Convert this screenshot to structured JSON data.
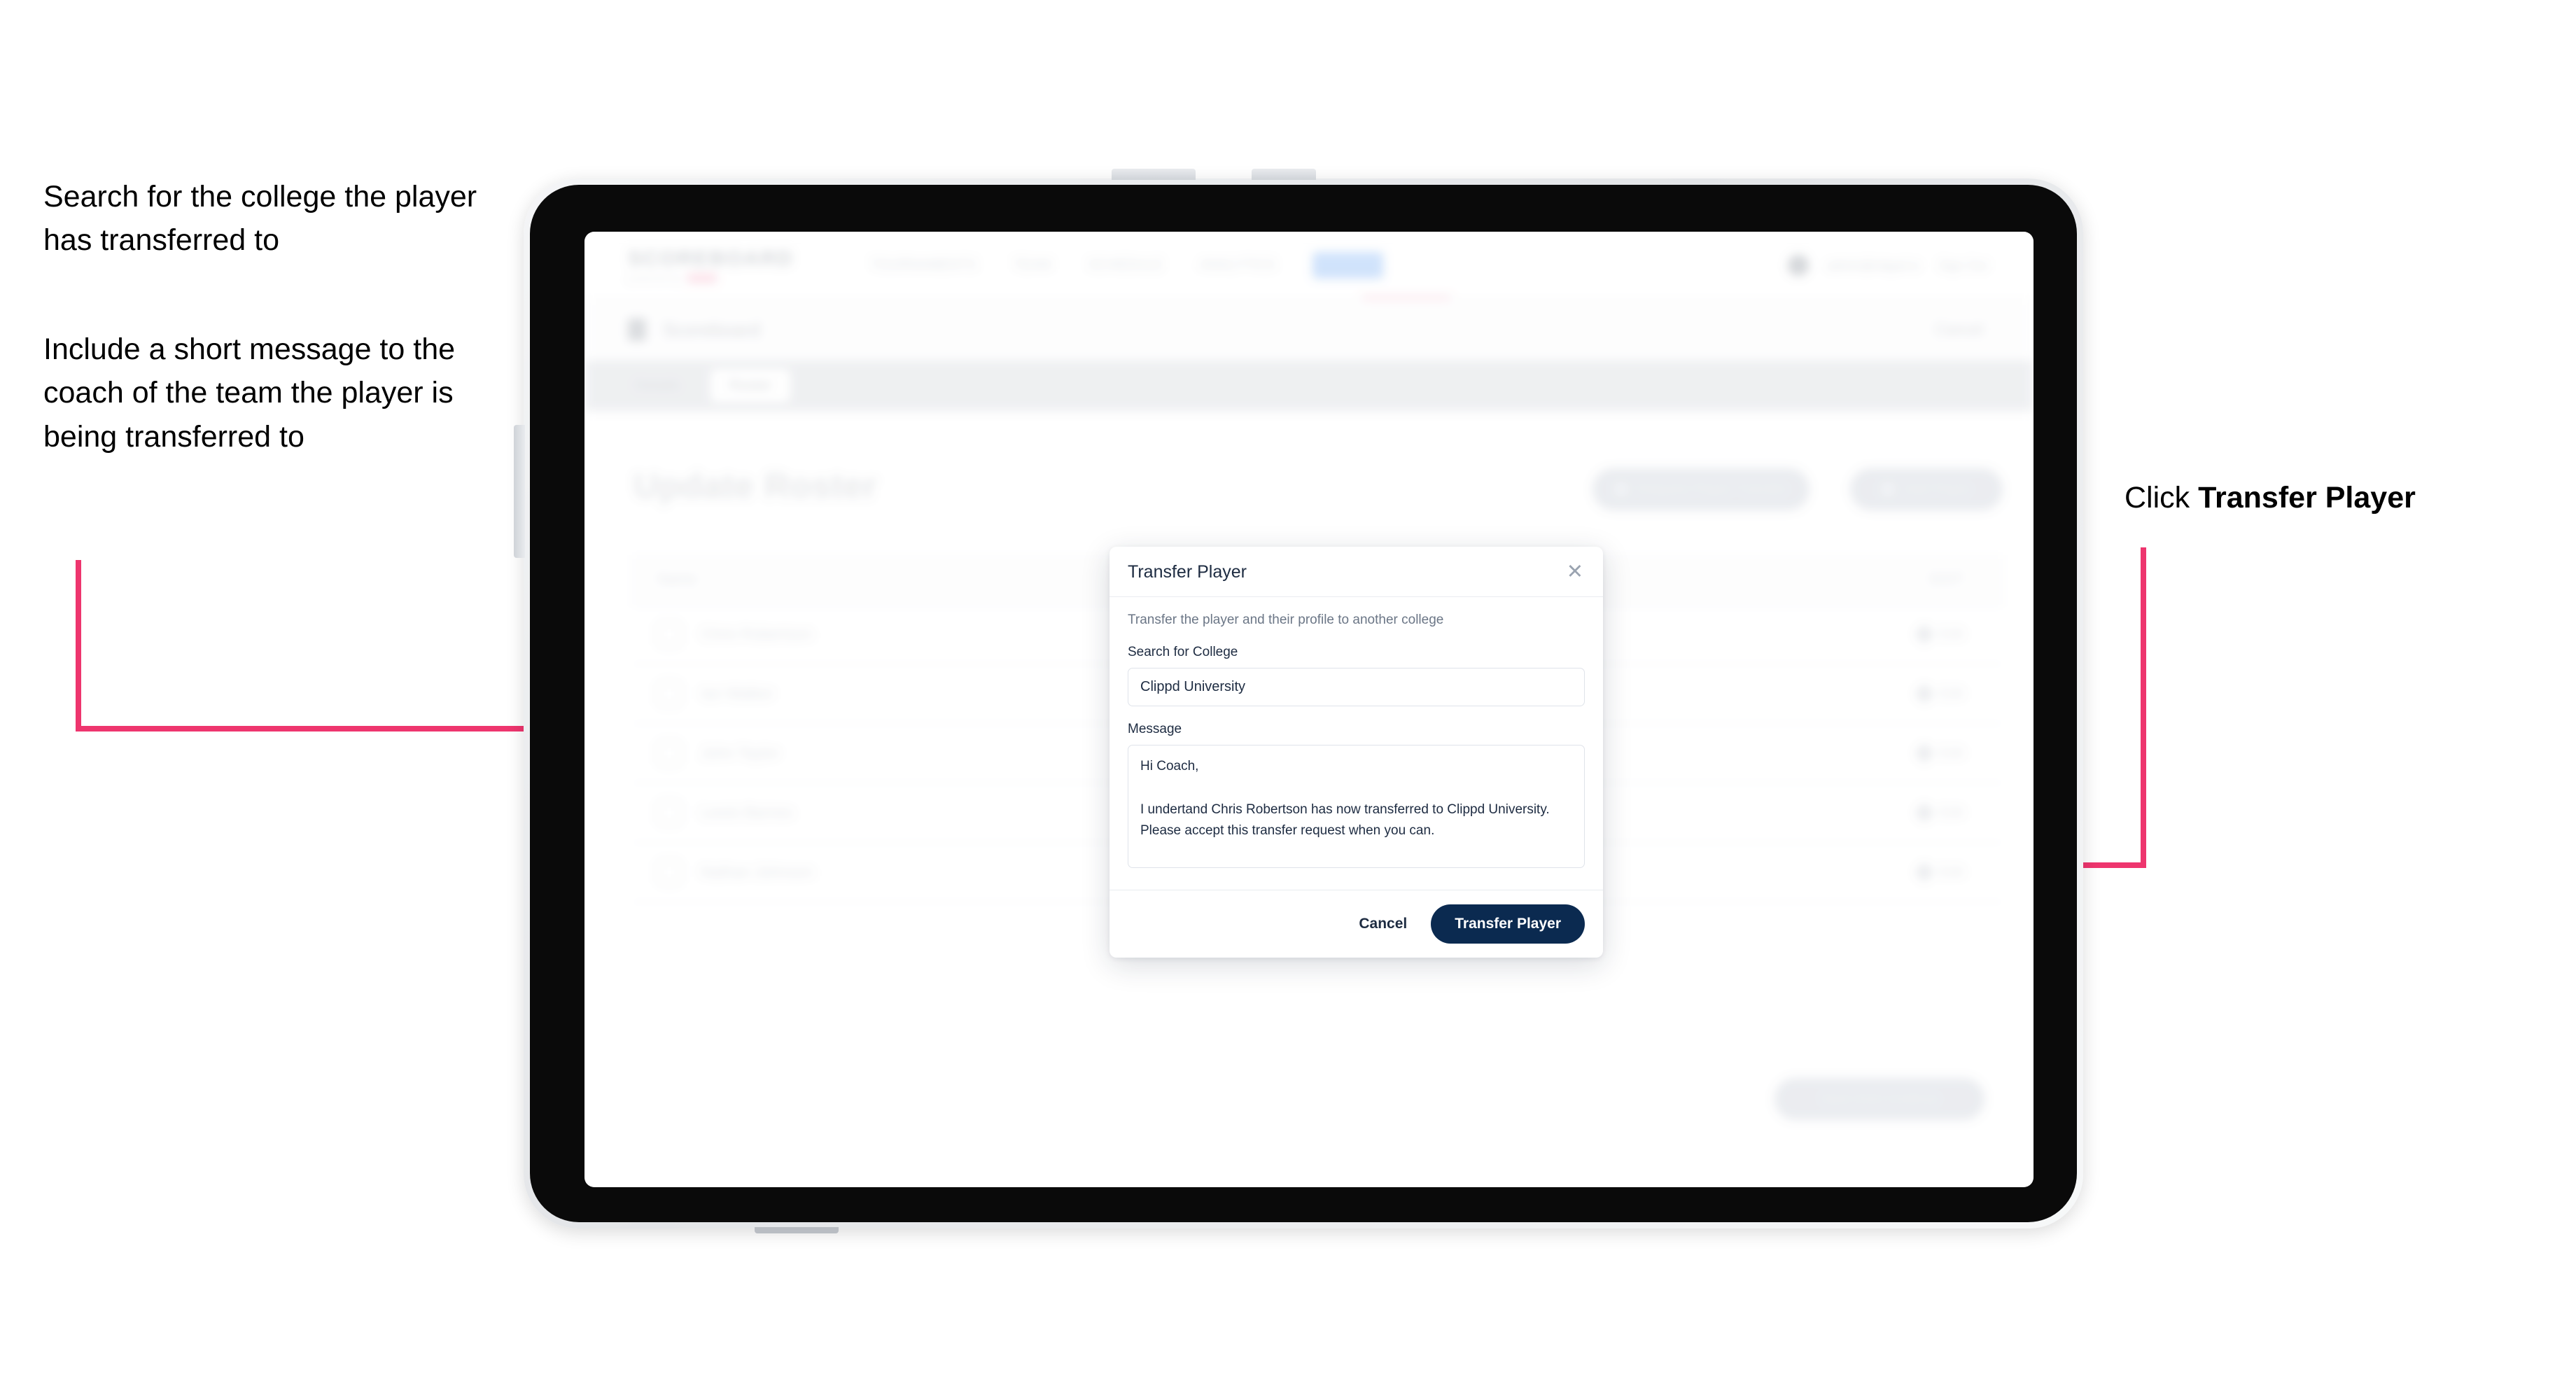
{
  "annotations": {
    "left_1": "Search for the college the player has transferred to",
    "left_2": "Include a short message to the coach of the team the player is being transferred to",
    "right_prefix": "Click ",
    "right_bold": "Transfer Player"
  },
  "colors": {
    "accent_pink": "#EE356E",
    "navy": "#0B2A50",
    "text_dark": "#1D2B41",
    "muted": "#6B7686",
    "border": "#DFE3EA"
  },
  "app": {
    "logo": {
      "main": "SCOREBOARD",
      "sub": "powered by",
      "sub_badge": "clippd"
    },
    "topnav": [
      {
        "label": "TOURNAMENTS"
      },
      {
        "label": "TEAM"
      },
      {
        "label": "SCHEDULE"
      },
      {
        "label": "ANALYTICS"
      },
      {
        "label": "ADMIN"
      }
    ],
    "top_right": {
      "user": "admin@clippd.io",
      "menu": "Sign Out"
    },
    "subbar": {
      "title": "Scoreboard",
      "title_suffix": "Admin",
      "right_action": "Cancel"
    },
    "tabs": [
      {
        "label": "Details",
        "active": false
      },
      {
        "label": "Roster",
        "active": true
      }
    ],
    "page_title": "Update Roster",
    "header_buttons": [
      {
        "label": "Request Player Transfer",
        "icon": "transfer-icon"
      },
      {
        "label": "Add Player",
        "icon": "plus-icon"
      }
    ],
    "roster_table": {
      "columns": [
        "Name",
        "EDIT"
      ],
      "rows": [
        {
          "name": "Chris Robertson",
          "action": "Edit"
        },
        {
          "name": "Ian Walker",
          "action": "Edit"
        },
        {
          "name": "John Taylor",
          "action": "Edit"
        },
        {
          "name": "Lewis Barnes",
          "action": "Edit"
        },
        {
          "name": "Nathan Johnson",
          "action": "Edit"
        }
      ]
    },
    "footer_button": "Save And Continue"
  },
  "modal": {
    "title": "Transfer Player",
    "close_icon": "close-icon",
    "description": "Transfer the player and their profile to another college",
    "college_label": "Search for College",
    "college_value": "Clippd University",
    "college_placeholder": "Search for College",
    "message_label": "Message",
    "message_value": "Hi Coach,\n\nI undertand Chris Robertson has now transferred to Clippd University. Please accept this transfer request when you can.",
    "message_placeholder": "Message",
    "cancel_label": "Cancel",
    "submit_label": "Transfer Player"
  }
}
